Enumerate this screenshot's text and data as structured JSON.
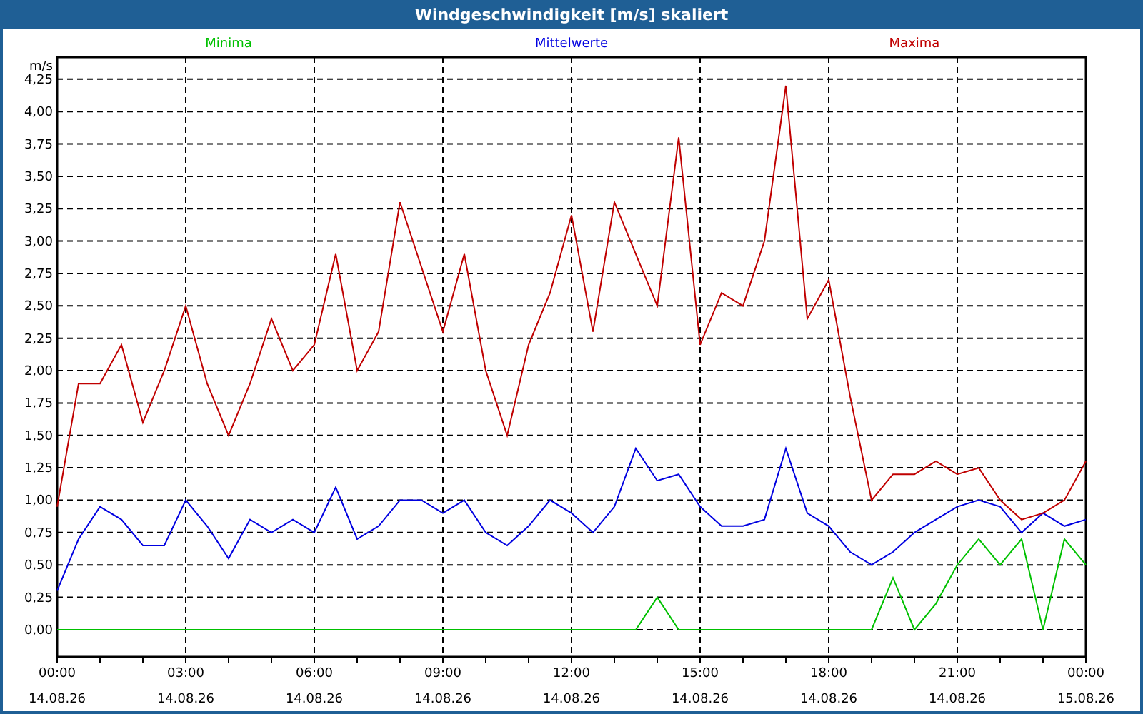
{
  "window": {
    "title": "Windgeschwindigkeit [m/s] skaliert"
  },
  "chart": {
    "x_dates": [
      "14.08.26",
      "14.08.26",
      "14.08.26",
      "14.08.26",
      "14.08.26",
      "14.08.26",
      "14.08.26",
      "14.08.26",
      "15.08.26"
    ],
    "chart_data": {
      "type": "line",
      "ylabel": "m/s",
      "xlim": [
        0,
        24
      ],
      "ylim": [
        -0.21,
        4.42
      ],
      "grid": true,
      "xticks": [
        {
          "value": 0,
          "label": "00:00"
        },
        {
          "value": 3,
          "label": "03:00"
        },
        {
          "value": 6,
          "label": "06:00"
        },
        {
          "value": 9,
          "label": "09:00"
        },
        {
          "value": 12,
          "label": "12:00"
        },
        {
          "value": 15,
          "label": "15:00"
        },
        {
          "value": 18,
          "label": "18:00"
        },
        {
          "value": 21,
          "label": "21:00"
        },
        {
          "value": 24,
          "label": "00:00"
        }
      ],
      "yticks": [
        {
          "value": 0,
          "label": "0,00"
        },
        {
          "value": 0.25,
          "label": "0,25"
        },
        {
          "value": 0.5,
          "label": "0,50"
        },
        {
          "value": 0.75,
          "label": "0,75"
        },
        {
          "value": 1,
          "label": "1,00"
        },
        {
          "value": 1.25,
          "label": "1,25"
        },
        {
          "value": 1.5,
          "label": "1,50"
        },
        {
          "value": 1.75,
          "label": "1,75"
        },
        {
          "value": 2,
          "label": "2,00"
        },
        {
          "value": 2.25,
          "label": "2,25"
        },
        {
          "value": 2.5,
          "label": "2,50"
        },
        {
          "value": 2.75,
          "label": "2,75"
        },
        {
          "value": 3,
          "label": "3,00"
        },
        {
          "value": 3.25,
          "label": "3,25"
        },
        {
          "value": 3.5,
          "label": "3,50"
        },
        {
          "value": 3.75,
          "label": "3,75"
        },
        {
          "value": 4,
          "label": "4,00"
        },
        {
          "value": 4.25,
          "label": "4,25"
        }
      ],
      "x": [
        0,
        0.5,
        1,
        1.5,
        2,
        2.5,
        3,
        3.5,
        4,
        4.5,
        5,
        5.5,
        6,
        6.5,
        7,
        7.5,
        8,
        8.5,
        9,
        9.5,
        10,
        10.5,
        11,
        11.5,
        12,
        12.5,
        13,
        13.5,
        14,
        14.5,
        15,
        15.5,
        16,
        16.5,
        17,
        17.5,
        18,
        18.5,
        19,
        19.5,
        20,
        20.5,
        21,
        21.5,
        22,
        22.5,
        23,
        23.5,
        24
      ],
      "series": [
        {
          "name": "Minima",
          "color": "#00c000",
          "values": [
            0,
            0,
            0,
            0,
            0,
            0,
            0,
            0,
            0,
            0,
            0,
            0,
            0,
            0,
            0,
            0,
            0,
            0,
            0,
            0,
            0,
            0,
            0,
            0,
            0,
            0,
            0,
            0,
            0.25,
            0,
            0,
            0,
            0,
            0,
            0,
            0,
            0,
            0,
            0,
            0.4,
            0,
            0.2,
            0.5,
            0.7,
            0.5,
            0.7,
            0,
            0.7,
            0.5
          ]
        },
        {
          "name": "Mittelwerte",
          "color": "#0000e0",
          "values": [
            0.3,
            0.7,
            0.95,
            0.85,
            0.65,
            0.65,
            1.0,
            0.8,
            0.55,
            0.85,
            0.75,
            0.85,
            0.75,
            1.1,
            0.7,
            0.8,
            1.0,
            1.0,
            0.9,
            1.0,
            0.75,
            0.65,
            0.8,
            1.0,
            0.9,
            0.75,
            0.95,
            1.4,
            1.15,
            1.2,
            0.95,
            0.8,
            0.8,
            0.85,
            1.4,
            0.9,
            0.8,
            0.6,
            0.5,
            0.6,
            0.75,
            0.85,
            0.95,
            1.0,
            0.95,
            0.75,
            0.9,
            0.8,
            0.85
          ]
        },
        {
          "name": "Maxima",
          "color": "#c00000",
          "values": [
            0.95,
            1.9,
            1.9,
            2.2,
            1.6,
            2.0,
            2.5,
            1.9,
            1.5,
            1.9,
            2.4,
            2.0,
            2.2,
            2.9,
            2.0,
            2.3,
            3.3,
            2.8,
            2.3,
            2.9,
            2.0,
            1.5,
            2.2,
            2.6,
            3.2,
            2.3,
            3.3,
            2.9,
            2.5,
            3.8,
            2.2,
            2.6,
            2.5,
            3.0,
            4.2,
            2.4,
            2.7,
            1.8,
            1.0,
            1.2,
            1.2,
            1.3,
            1.2,
            1.25,
            1.0,
            0.85,
            0.9,
            1.0,
            1.3
          ]
        }
      ]
    }
  }
}
